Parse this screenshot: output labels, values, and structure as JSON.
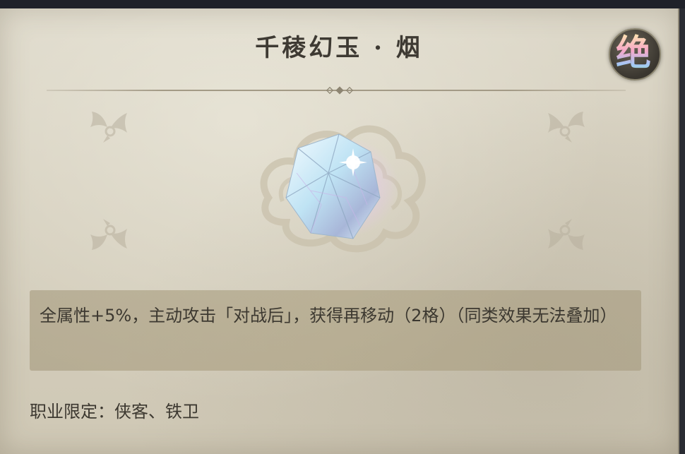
{
  "item": {
    "name": "千稜幻玉 · 烟",
    "rarity_label": "绝",
    "description": "全属性+5%，主动攻击「对战后」，获得再移动（2格）（同类效果无法叠加）",
    "job_restriction": "职业限定：侠客、铁卫"
  },
  "colors": {
    "panel": "#d6d0bf",
    "text": "#3c3830",
    "desc_box": "#a8996f"
  },
  "icons": {
    "item_image": "crystal-gem-icon",
    "rarity": "rarity-badge-icon"
  }
}
